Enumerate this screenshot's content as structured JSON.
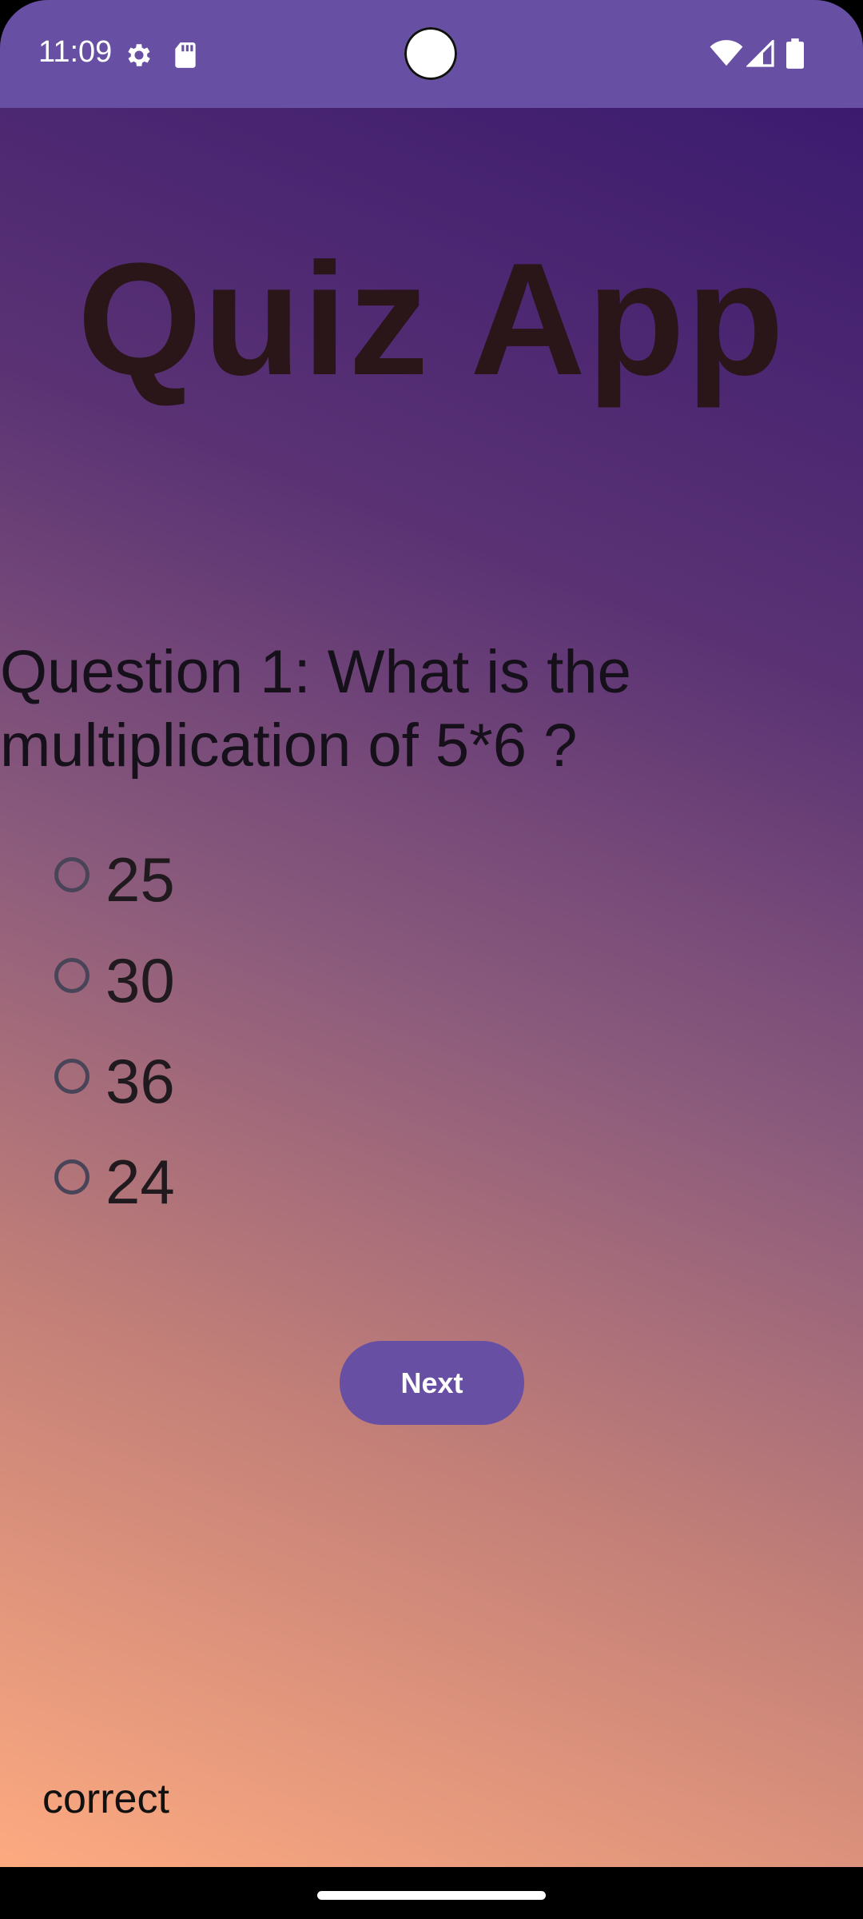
{
  "status_bar": {
    "time": "11:09",
    "left_icons": [
      "gear-icon",
      "sd-card-icon"
    ],
    "right_icons": [
      "wifi-icon",
      "signal-icon",
      "battery-icon"
    ],
    "color": "#6750A4"
  },
  "app": {
    "title": "Quiz App"
  },
  "quiz": {
    "question": "Question 1: What is the multiplication of 5*6 ?",
    "options": [
      {
        "label": "25",
        "selected": false
      },
      {
        "label": "30",
        "selected": false
      },
      {
        "label": "36",
        "selected": false
      },
      {
        "label": "24",
        "selected": false
      }
    ],
    "next_label": "Next",
    "feedback": "correct"
  },
  "colors": {
    "accent": "#6750A4",
    "title_text": "#2A1519",
    "gradient_top": "#3C1B6F",
    "gradient_bottom": "#FDAA80"
  }
}
